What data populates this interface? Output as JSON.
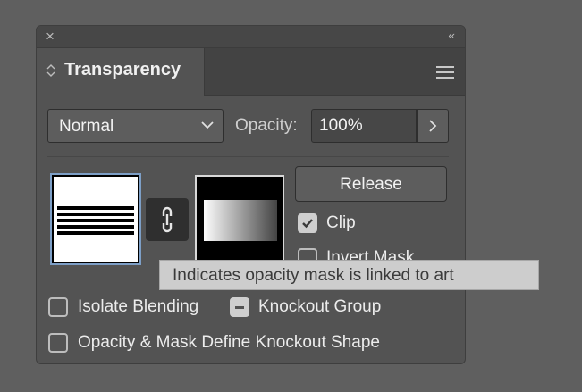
{
  "panel": {
    "close_glyph": "×",
    "collapse_glyph": "‹‹",
    "tab_label": "Transparency"
  },
  "blend": {
    "selected": "Normal"
  },
  "opacity": {
    "label": "Opacity:",
    "value": "100%"
  },
  "mask": {
    "release_label": "Release",
    "clip_label": "Clip",
    "clip_checked": true,
    "invert_label": "Invert Mask",
    "invert_checked": false,
    "link_tooltip": "Indicates opacity mask is linked to art"
  },
  "options": {
    "isolate_label": "Isolate Blending",
    "isolate_checked": false,
    "knockout_label": "Knockout Group",
    "knockout_state": "mixed",
    "define_label": "Opacity & Mask Define Knockout Shape",
    "define_checked": false
  },
  "icons": {
    "close": "close-icon",
    "collapse": "double-chevron-left-icon",
    "tab_grip": "diamond-updown-icon",
    "panel_menu": "hamburger-menu-icon",
    "dropdown": "chevron-down-icon",
    "opacity_flyout": "chevron-right-icon",
    "link": "chain-link-icon",
    "check": "checkmark-icon"
  },
  "colors": {
    "panel_bg": "#535353",
    "background": "#5f5f5f",
    "tooltip_bg": "#cdcdcd",
    "selection_border": "#7d9fc7"
  }
}
